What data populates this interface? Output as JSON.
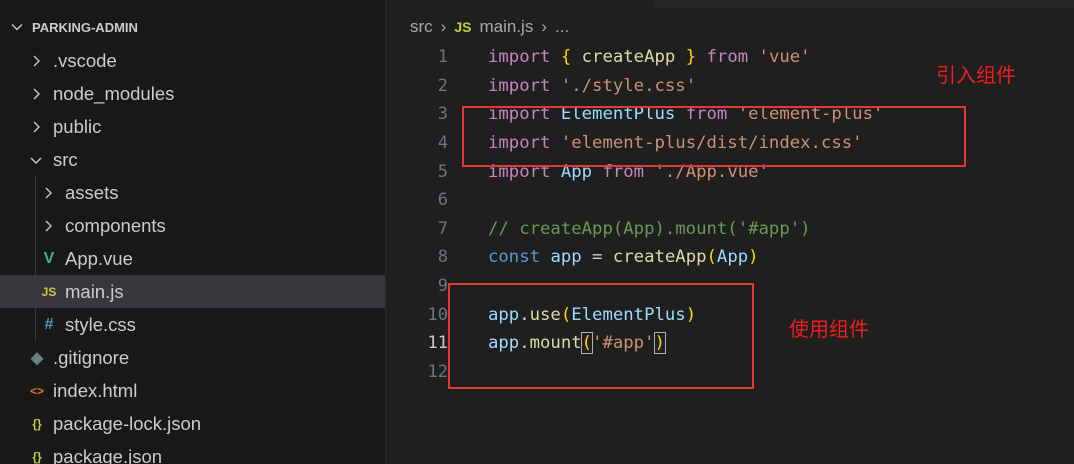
{
  "explorer": {
    "root_label": "PARKING-ADMIN",
    "items": [
      {
        "label": ".vscode",
        "type": "folder",
        "depth": 1,
        "expanded": false,
        "icon": "chevron-right-icon"
      },
      {
        "label": "node_modules",
        "type": "folder",
        "depth": 1,
        "expanded": false,
        "icon": "chevron-right-icon"
      },
      {
        "label": "public",
        "type": "folder",
        "depth": 1,
        "expanded": false,
        "icon": "chevron-right-icon"
      },
      {
        "label": "src",
        "type": "folder",
        "depth": 1,
        "expanded": true,
        "icon": "chevron-down-icon"
      },
      {
        "label": "assets",
        "type": "folder",
        "depth": 2,
        "expanded": false,
        "icon": "chevron-right-icon"
      },
      {
        "label": "components",
        "type": "folder",
        "depth": 2,
        "expanded": false,
        "icon": "chevron-right-icon"
      },
      {
        "label": "App.vue",
        "type": "file",
        "depth": 2,
        "icon": "vue-file-icon",
        "icon_glyph": "V",
        "icon_color": "#41b883"
      },
      {
        "label": "main.js",
        "type": "file",
        "depth": 2,
        "icon": "js-file-icon",
        "icon_glyph": "JS",
        "icon_color": "#cbcb41",
        "selected": true
      },
      {
        "label": "style.css",
        "type": "file",
        "depth": 2,
        "icon": "css-file-icon",
        "icon_glyph": "#",
        "icon_color": "#519aba"
      },
      {
        "label": ".gitignore",
        "type": "file",
        "depth": 1,
        "icon": "git-file-icon",
        "icon_glyph": "◆",
        "icon_color": "#6d8086"
      },
      {
        "label": "index.html",
        "type": "file",
        "depth": 1,
        "icon": "html-file-icon",
        "icon_glyph": "<>",
        "icon_color": "#e37933"
      },
      {
        "label": "package-lock.json",
        "type": "file",
        "depth": 1,
        "icon": "json-file-icon",
        "icon_glyph": "{}",
        "icon_color": "#cbcb41"
      },
      {
        "label": "package.json",
        "type": "file",
        "depth": 1,
        "icon": "json-file-icon",
        "icon_glyph": "{}",
        "icon_color": "#cbcb41"
      }
    ]
  },
  "breadcrumb": {
    "folder": "src",
    "file_icon": "JS",
    "file": "main.js",
    "trail": "..."
  },
  "editor": {
    "active_line": 11,
    "lines": [
      {
        "num": "1",
        "tokens": [
          [
            "kw",
            "import"
          ],
          [
            "pl",
            " "
          ],
          [
            "br1",
            "{"
          ],
          [
            "pl",
            " "
          ],
          [
            "fn",
            "createApp"
          ],
          [
            "pl",
            " "
          ],
          [
            "br1",
            "}"
          ],
          [
            "pl",
            " "
          ],
          [
            "kw",
            "from"
          ],
          [
            "pl",
            " "
          ],
          [
            "str",
            "'vue'"
          ]
        ]
      },
      {
        "num": "2",
        "tokens": [
          [
            "kw",
            "import"
          ],
          [
            "pl",
            " "
          ],
          [
            "str",
            "'./style.css'"
          ]
        ]
      },
      {
        "num": "3",
        "tokens": [
          [
            "kw",
            "import"
          ],
          [
            "pl",
            " "
          ],
          [
            "var",
            "ElementPlus"
          ],
          [
            "pl",
            " "
          ],
          [
            "kw",
            "from"
          ],
          [
            "pl",
            " "
          ],
          [
            "str",
            "'element-plus'"
          ]
        ]
      },
      {
        "num": "4",
        "tokens": [
          [
            "kw",
            "import"
          ],
          [
            "pl",
            " "
          ],
          [
            "str",
            "'element-plus/dist/index.css'"
          ]
        ]
      },
      {
        "num": "5",
        "tokens": [
          [
            "kw",
            "import"
          ],
          [
            "pl",
            " "
          ],
          [
            "var",
            "App"
          ],
          [
            "pl",
            " "
          ],
          [
            "kw",
            "from"
          ],
          [
            "pl",
            " "
          ],
          [
            "str",
            "'./App.vue'"
          ]
        ]
      },
      {
        "num": "6",
        "tokens": []
      },
      {
        "num": "7",
        "tokens": [
          [
            "cm",
            "// createApp(App).mount('#app')"
          ]
        ]
      },
      {
        "num": "8",
        "tokens": [
          [
            "bl",
            "const"
          ],
          [
            "pl",
            " "
          ],
          [
            "var",
            "app"
          ],
          [
            "pl",
            " = "
          ],
          [
            "fn",
            "createApp"
          ],
          [
            "br1",
            "("
          ],
          [
            "var",
            "App"
          ],
          [
            "br1",
            ")"
          ]
        ]
      },
      {
        "num": "9",
        "tokens": []
      },
      {
        "num": "10",
        "tokens": [
          [
            "var",
            "app"
          ],
          [
            "pl",
            "."
          ],
          [
            "fn",
            "use"
          ],
          [
            "br1",
            "("
          ],
          [
            "var",
            "ElementPlus"
          ],
          [
            "br1",
            ")"
          ]
        ]
      },
      {
        "num": "11",
        "tokens": [
          [
            "var",
            "app"
          ],
          [
            "pl",
            "."
          ],
          [
            "fn",
            "mount"
          ],
          [
            "br1",
            "("
          ],
          [
            "str",
            "'#app'"
          ],
          [
            "br1",
            ")"
          ]
        ]
      },
      {
        "num": "12",
        "tokens": []
      }
    ]
  },
  "annotations": {
    "import_label": "引入组件",
    "use_label": "使用组件",
    "color": "#e53935"
  }
}
